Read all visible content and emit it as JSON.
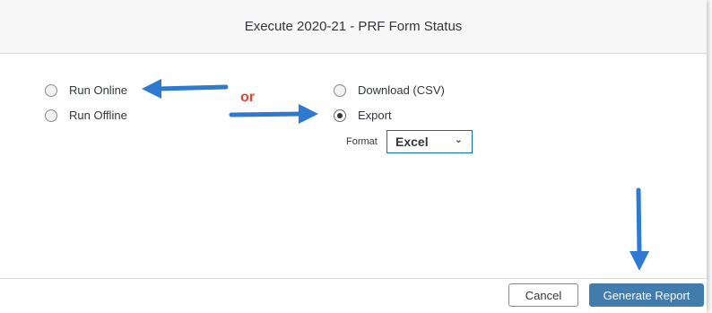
{
  "dialog": {
    "title": "Execute 2020-21 - PRF Form Status"
  },
  "run_mode": {
    "options": [
      {
        "label": "Run Online",
        "selected": false
      },
      {
        "label": "Run Offline",
        "selected": false
      }
    ]
  },
  "annotation": {
    "or_text": "or",
    "arrow_color": "#2e7ad1",
    "or_color": "#e8433a"
  },
  "output_mode": {
    "options": [
      {
        "label": "Download (CSV)",
        "selected": false
      },
      {
        "label": "Export",
        "selected": true
      }
    ],
    "format_label": "Format",
    "format_value": "Excel"
  },
  "footer": {
    "cancel_label": "Cancel",
    "generate_label": "Generate Report"
  },
  "colors": {
    "primary_button": "#427cac",
    "select_border": "#0a6ed1"
  }
}
